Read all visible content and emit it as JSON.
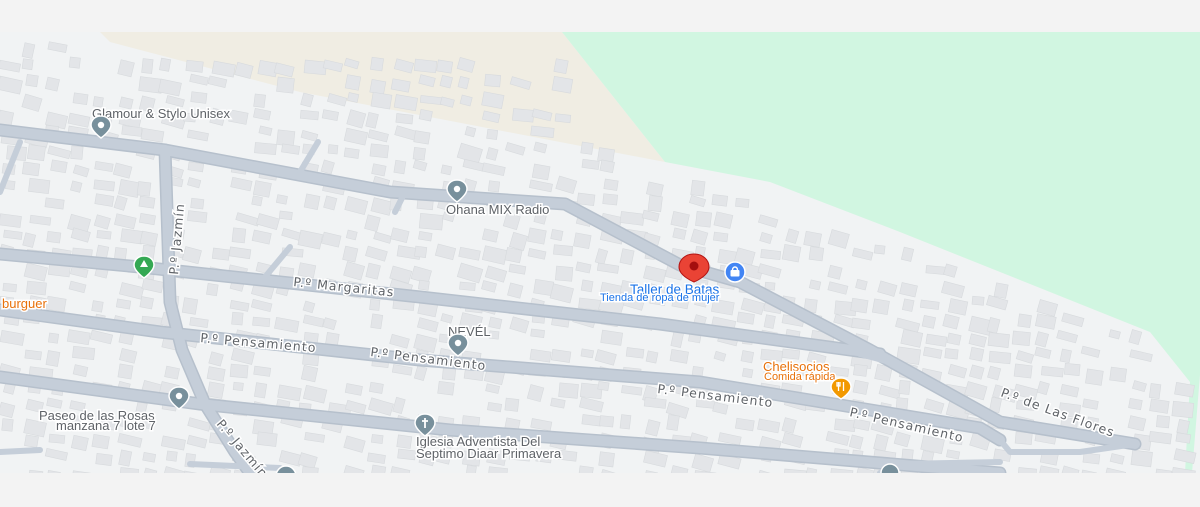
{
  "colors": {
    "park": "#d1f6e1",
    "sand": "#f0ede3",
    "urban": "#f1f3f4",
    "road": "#c5ced9",
    "building": "#e3e5e8",
    "selected_pin": "#ea4335",
    "shopping_pin": "#4285f4",
    "food_pin": "#f29900",
    "generic_pin": "#78909c",
    "park_pin": "#34a853"
  },
  "streets": [
    {
      "id": "jazmin-north",
      "label": "P.º Jazmín"
    },
    {
      "id": "margaritas",
      "label": "P.º Margaritas"
    },
    {
      "id": "pensamiento-1",
      "label": "P.º Pensamiento"
    },
    {
      "id": "pensamiento-2",
      "label": "P.º Pensamiento"
    },
    {
      "id": "pensamiento-3",
      "label": "P.º Pensamiento"
    },
    {
      "id": "pensamiento-4",
      "label": "P.º Pensamiento"
    },
    {
      "id": "flores",
      "label": "P.º de Las Flores"
    },
    {
      "id": "jazmin-south",
      "label": "P.º Jazmín"
    }
  ],
  "places": [
    {
      "id": "glamour",
      "name": "Glamour & Stylo Unisex",
      "icon": "generic-pin-icon"
    },
    {
      "id": "ohana",
      "name": "Ohana MIX Radio",
      "icon": "generic-pin-icon"
    },
    {
      "id": "taller",
      "name": "Taller de Batas",
      "subtitle": "Tienda de ropa de mujer",
      "icon": "shopping-bag-pin-icon"
    },
    {
      "id": "nevel",
      "name": "NEVÉL",
      "icon": "generic-pin-icon"
    },
    {
      "id": "chelisocios",
      "name": "Chelisocios",
      "subtitle": "Comida rápida",
      "icon": "restaurant-pin-icon"
    },
    {
      "id": "paseo",
      "name": "Paseo de las Rosas",
      "subtitle": "manzana 7 lote 7",
      "icon": "generic-pin-icon"
    },
    {
      "id": "iglesia",
      "name": "Iglesia Adventista Del",
      "subtitle": "Septimo Diaar Primavera",
      "icon": "church-pin-icon"
    },
    {
      "id": "burguer",
      "name": "burguer"
    }
  ],
  "selected_marker": {
    "icon": "red-location-pin-icon"
  }
}
